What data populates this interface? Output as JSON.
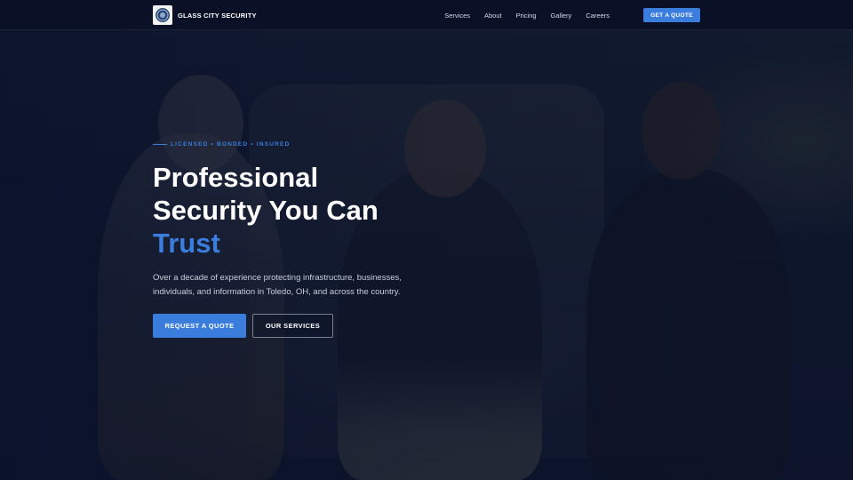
{
  "nav": {
    "brand_name": "GLASS CITY SECURITY",
    "logo_icon": "shield-badge-icon",
    "links": [
      "Services",
      "About",
      "Pricing",
      "Gallery",
      "Careers"
    ],
    "cta_label": "GET A QUOTE"
  },
  "hero": {
    "eyebrow": "LICENSED • BONDED • INSURED",
    "headline_line1": "Professional",
    "headline_line2": "Security You Can",
    "headline_accent": "Trust",
    "subtext": "Over a decade of experience protecting infrastructure, businesses, individuals, and information in Toledo, OH, and across the country.",
    "primary_button": "REQUEST A QUOTE",
    "secondary_button": "OUR SERVICES"
  },
  "colors": {
    "accent": "#3b7ddd",
    "nav_bg": "#0a1026",
    "overlay": "#0a122d"
  }
}
